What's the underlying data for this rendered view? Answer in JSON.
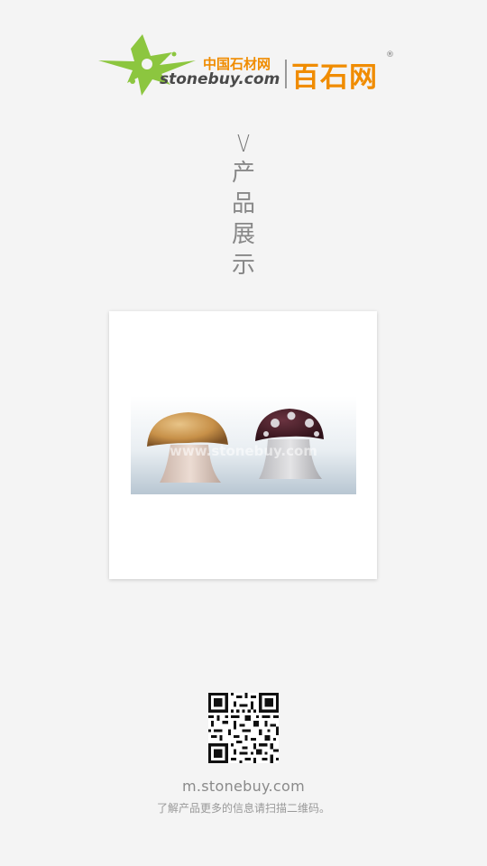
{
  "logo": {
    "cn_small": "中国石材网",
    "domain": "stonebuy.com",
    "cn_big": "百石网",
    "registered": "®"
  },
  "title": {
    "marker": "V",
    "chars": [
      "产",
      "品",
      "展",
      "示"
    ]
  },
  "product": {
    "watermark": "www.stonebuy.com"
  },
  "footer": {
    "url": "m.stonebuy.com",
    "hint": "了解产品更多的信息请扫描二维码。"
  },
  "colors": {
    "background": "#f4f4f4",
    "brand_green": "#8cc63f",
    "brand_orange": "#f08c00"
  },
  "icons": {
    "logo_mark": "star-burst-icon",
    "qr": "qr-code-icon"
  }
}
